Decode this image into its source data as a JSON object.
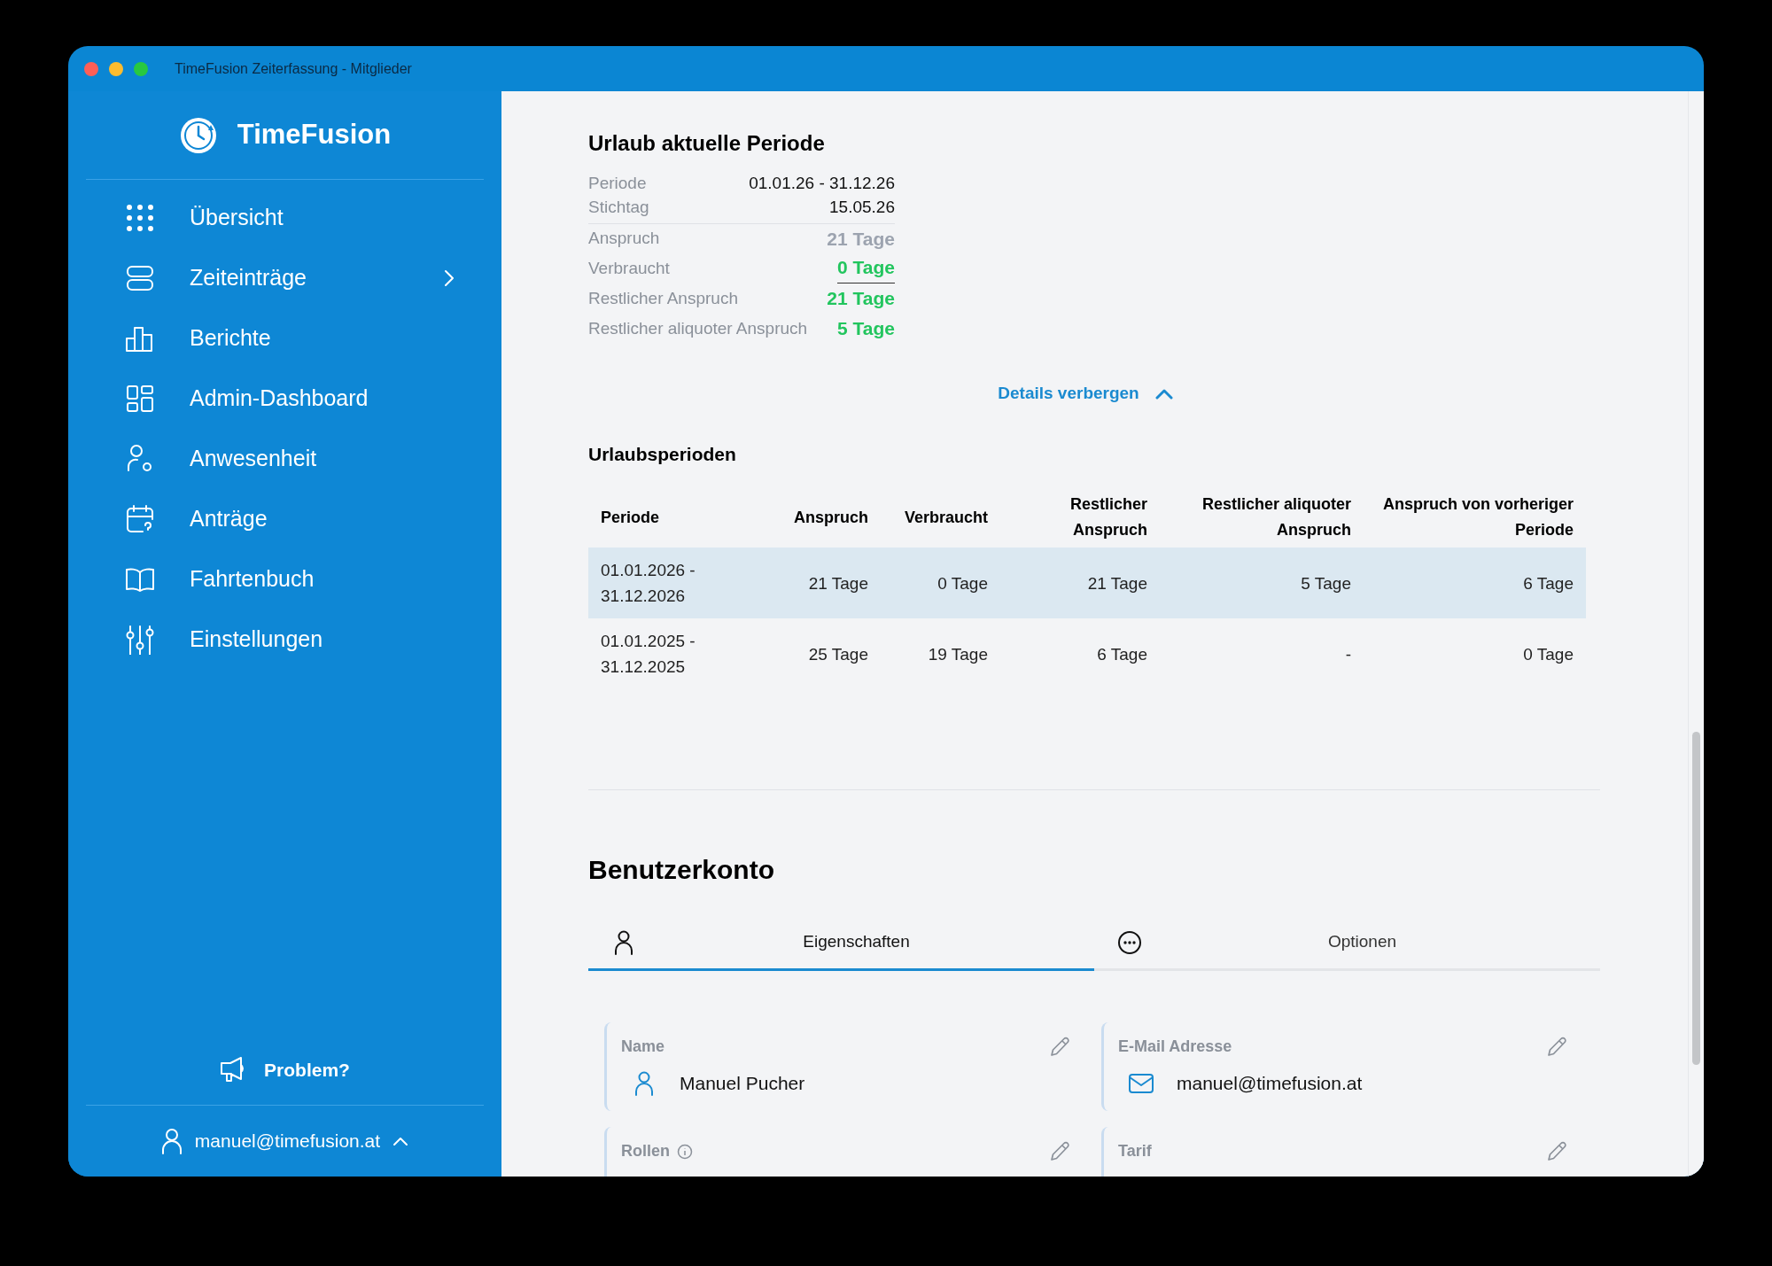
{
  "window": {
    "title": "TimeFusion Zeiterfassung - Mitglieder"
  },
  "sidebar": {
    "brand": "TimeFusion",
    "items": [
      {
        "label": "Übersicht",
        "has_submenu": false
      },
      {
        "label": "Zeiteinträge",
        "has_submenu": true
      },
      {
        "label": "Berichte",
        "has_submenu": false
      },
      {
        "label": "Admin-Dashboard",
        "has_submenu": false
      },
      {
        "label": "Anwesenheit",
        "has_submenu": false
      },
      {
        "label": "Anträge",
        "has_submenu": false
      },
      {
        "label": "Fahrtenbuch",
        "has_submenu": false
      },
      {
        "label": "Einstellungen",
        "has_submenu": false
      }
    ],
    "problem": "Problem?",
    "user": "manuel@timefusion.at"
  },
  "vacation_summary": {
    "title": "Urlaub aktuelle Periode",
    "rows": [
      {
        "label": "Periode",
        "value": "01.01.26 - 31.12.26",
        "kind": "info"
      },
      {
        "label": "Stichtag",
        "value": "15.05.26",
        "kind": "info"
      },
      {
        "label": "Anspruch",
        "value": "21 Tage",
        "kind": "entitlement"
      },
      {
        "label": "Verbraucht",
        "value": "0 Tage",
        "kind": "used"
      },
      {
        "label": "Restlicher Anspruch",
        "value": "21 Tage",
        "kind": "remaining"
      },
      {
        "label": "Restlicher aliquoter Anspruch",
        "value": "5 Tage",
        "kind": "remaining"
      }
    ],
    "toggle": "Details verbergen"
  },
  "periods": {
    "title": "Urlaubsperioden",
    "columns": [
      "Periode",
      "Anspruch",
      "Verbraucht",
      "Restlicher Anspruch",
      "Restlicher aliquoter Anspruch",
      "Anspruch von vorheriger Periode"
    ],
    "rows": [
      {
        "selected": true,
        "cells": [
          "01.01.2026 - 31.12.2026",
          "21 Tage",
          "0 Tage",
          "21 Tage",
          "5 Tage",
          "6 Tage"
        ]
      },
      {
        "selected": false,
        "cells": [
          "01.01.2025 - 31.12.2025",
          "25 Tage",
          "19 Tage",
          "6 Tage",
          "-",
          "0 Tage"
        ]
      }
    ]
  },
  "account": {
    "title": "Benutzerkonto",
    "tabs": [
      {
        "label": "Eigenschaften",
        "selected": true
      },
      {
        "label": "Optionen",
        "selected": false
      }
    ],
    "fields": [
      {
        "label": "Name",
        "value": "Manuel Pucher",
        "info": false
      },
      {
        "label": "E-Mail Adresse",
        "value": "manuel@timefusion.at",
        "info": false
      },
      {
        "label": "Rollen",
        "info": true
      },
      {
        "label": "Tarif",
        "info": false
      }
    ]
  }
}
